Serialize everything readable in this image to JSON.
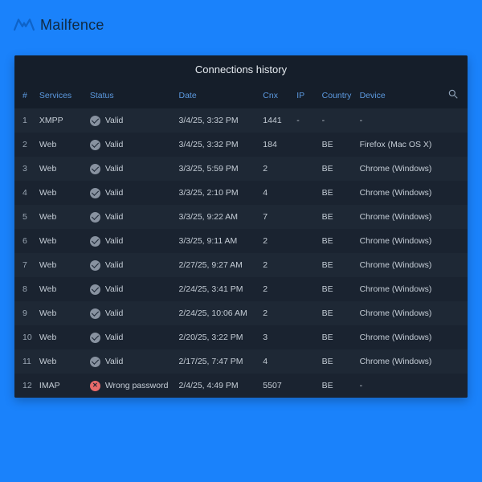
{
  "brand": {
    "name": "Mailfence"
  },
  "panel": {
    "title": "Connections history",
    "columns": {
      "num": "#",
      "services": "Services",
      "status": "Status",
      "date": "Date",
      "cnx": "Cnx",
      "ip": "IP",
      "country": "Country",
      "device": "Device"
    },
    "rows": [
      {
        "num": "1",
        "service": "XMPP",
        "status_kind": "valid",
        "status_label": "Valid",
        "date": "3/4/25, 3:32 PM",
        "cnx": "1441",
        "ip": "-",
        "country": "-",
        "device": "-"
      },
      {
        "num": "2",
        "service": "Web",
        "status_kind": "valid",
        "status_label": "Valid",
        "date": "3/4/25, 3:32 PM",
        "cnx": "184",
        "ip": "",
        "country": "BE",
        "device": "Firefox (Mac OS X)"
      },
      {
        "num": "3",
        "service": "Web",
        "status_kind": "valid",
        "status_label": "Valid",
        "date": "3/3/25, 5:59 PM",
        "cnx": "2",
        "ip": "",
        "country": "BE",
        "device": "Chrome (Windows)"
      },
      {
        "num": "4",
        "service": "Web",
        "status_kind": "valid",
        "status_label": "Valid",
        "date": "3/3/25, 2:10 PM",
        "cnx": "4",
        "ip": "",
        "country": "BE",
        "device": "Chrome (Windows)"
      },
      {
        "num": "5",
        "service": "Web",
        "status_kind": "valid",
        "status_label": "Valid",
        "date": "3/3/25, 9:22 AM",
        "cnx": "7",
        "ip": "",
        "country": "BE",
        "device": "Chrome (Windows)"
      },
      {
        "num": "6",
        "service": "Web",
        "status_kind": "valid",
        "status_label": "Valid",
        "date": "3/3/25, 9:11 AM",
        "cnx": "2",
        "ip": "",
        "country": "BE",
        "device": "Chrome (Windows)"
      },
      {
        "num": "7",
        "service": "Web",
        "status_kind": "valid",
        "status_label": "Valid",
        "date": "2/27/25, 9:27 AM",
        "cnx": "2",
        "ip": "",
        "country": "BE",
        "device": "Chrome (Windows)"
      },
      {
        "num": "8",
        "service": "Web",
        "status_kind": "valid",
        "status_label": "Valid",
        "date": "2/24/25, 3:41 PM",
        "cnx": "2",
        "ip": "",
        "country": "BE",
        "device": "Chrome (Windows)"
      },
      {
        "num": "9",
        "service": "Web",
        "status_kind": "valid",
        "status_label": "Valid",
        "date": "2/24/25, 10:06 AM",
        "cnx": "2",
        "ip": "",
        "country": "BE",
        "device": "Chrome (Windows)"
      },
      {
        "num": "10",
        "service": "Web",
        "status_kind": "valid",
        "status_label": "Valid",
        "date": "2/20/25, 3:22 PM",
        "cnx": "3",
        "ip": "",
        "country": "BE",
        "device": "Chrome (Windows)"
      },
      {
        "num": "11",
        "service": "Web",
        "status_kind": "valid",
        "status_label": "Valid",
        "date": "2/17/25, 7:47 PM",
        "cnx": "4",
        "ip": "",
        "country": "BE",
        "device": "Chrome (Windows)"
      },
      {
        "num": "12",
        "service": "IMAP",
        "status_kind": "error",
        "status_label": "Wrong password",
        "date": "2/4/25, 4:49 PM",
        "cnx": "5507",
        "ip": "",
        "country": "BE",
        "device": "-"
      }
    ]
  }
}
